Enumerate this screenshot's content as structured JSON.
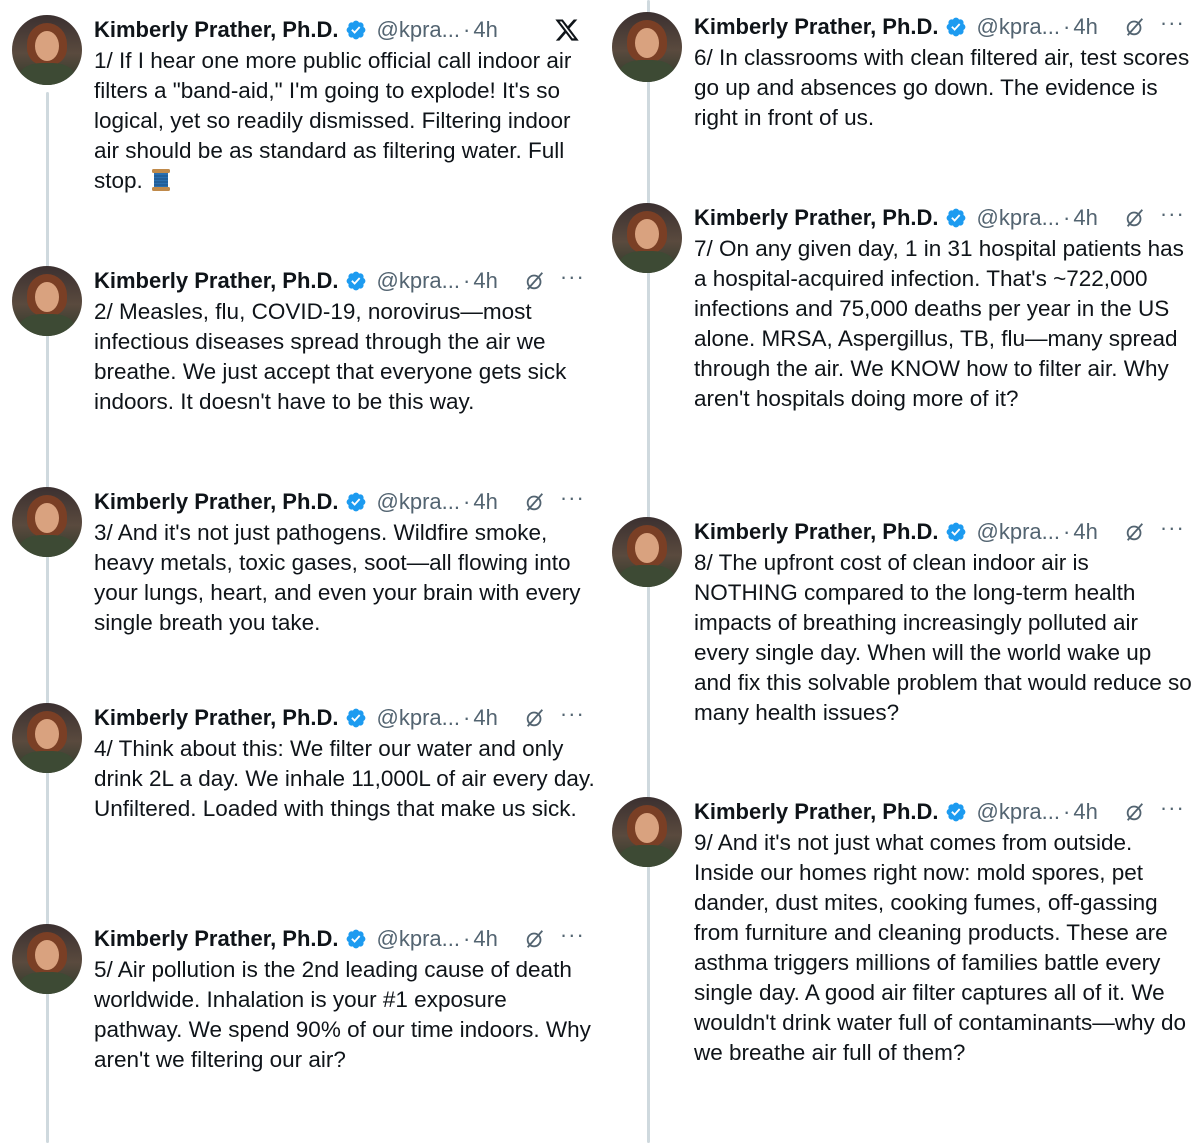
{
  "author": {
    "name": "Kimberly Prather, Ph.D.",
    "handle": "@kpra...",
    "time": "4h",
    "separator": "·",
    "more": "···"
  },
  "icons": {
    "verified": "verified-badge-icon",
    "grok": "grok-icon",
    "more": "more-options-icon",
    "x_logo": "x-logo-icon",
    "spool": "spool-of-thread-emoji",
    "accent": "#1d9bf0"
  },
  "tweets": [
    {
      "text": "1/ If I hear one more public official call indoor air filters a \"band-aid,\" I'm going to explode! It's so logical, yet so readily dismissed. Filtering indoor air should be as standard as filtering water. Full stop."
    },
    {
      "text": "2/ Measles, flu, COVID-19, norovirus—most infectious diseases spread through the air we breathe. We just accept that everyone gets sick indoors. It doesn't have to be this way."
    },
    {
      "text": "3/ And it's not just pathogens. Wildfire smoke, heavy metals, toxic gases, soot—all flowing into your lungs, heart, and even your brain with every single breath you take."
    },
    {
      "text": "4/ Think about this: We filter our water and only drink 2L a day. We inhale 11,000L of air every day. Unfiltered. Loaded with things that make us sick."
    },
    {
      "text": "5/ Air pollution is the 2nd leading cause of death worldwide. Inhalation is your #1 exposure pathway. We spend 90% of our time indoors. Why aren't we filtering our air?"
    },
    {
      "text": "6/ In classrooms with clean filtered air, test scores go up and absences go down. The evidence is right in front of us."
    },
    {
      "text": "7/ On any given day, 1 in 31 hospital patients has a hospital-acquired infection. That's ~722,000 infections and 75,000 deaths per year in the US alone. MRSA, Aspergillus, TB, flu—many spread through the air. We KNOW how to filter air. Why aren't hospitals doing more of it?"
    },
    {
      "text": "8/ The upfront cost of clean indoor air is NOTHING compared to the long-term health impacts of breathing increasingly polluted air every single day. When will the world wake up and fix this solvable problem that would reduce so many health issues?"
    },
    {
      "text": "9/ And it's not just what comes from outside. Inside our homes right now: mold spores, pet dander, dust mites, cooking fumes, off-gassing from furniture and cleaning products. These are asthma triggers millions of families battle every single day. A good air filter captures all of it. We wouldn't drink water full of contaminants—why do we breathe air full of them?"
    }
  ]
}
